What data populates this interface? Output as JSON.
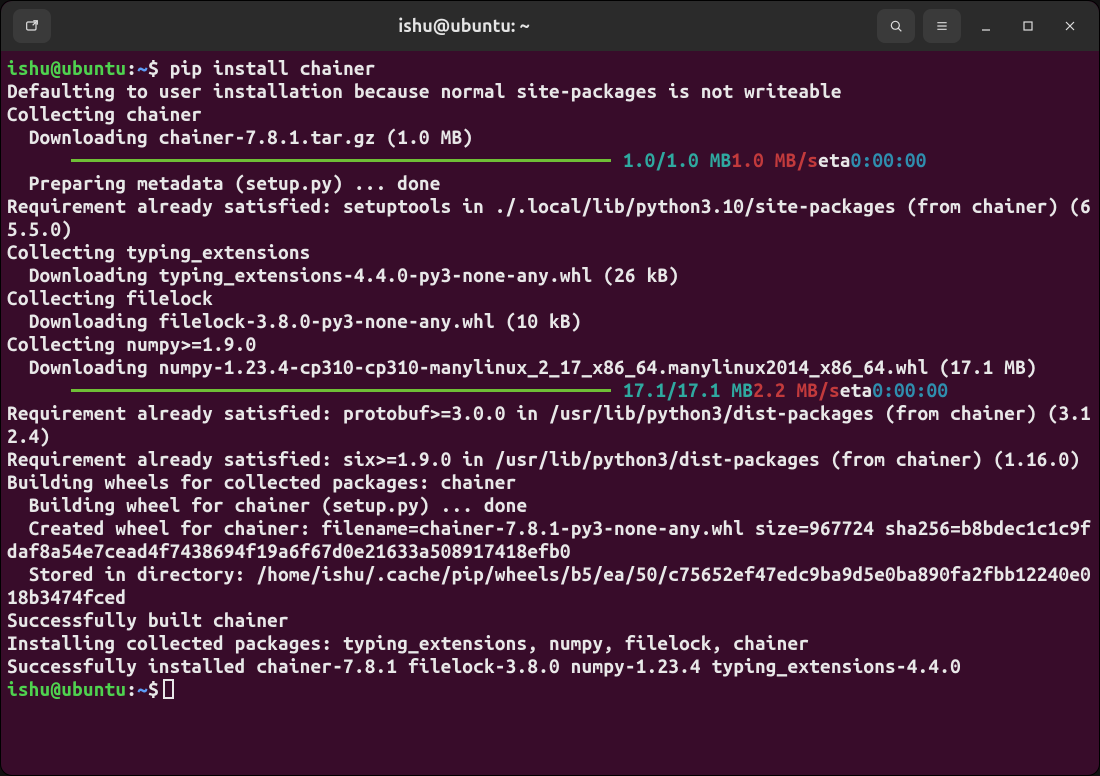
{
  "titlebar": {
    "title": "ishu@ubuntu: ~"
  },
  "prompt": {
    "user_host": "ishu@ubuntu",
    "sep": ":",
    "path": "~",
    "symbol": "$"
  },
  "command": "pip install chainer",
  "lines": {
    "l1": "Defaulting to user installation because normal site-packages is not writeable",
    "l2": "Collecting chainer",
    "l3": "  Downloading chainer-7.8.1.tar.gz (1.0 MB)",
    "progress1": {
      "done": "1.0/1.0 MB",
      "speed": "1.0 MB/s",
      "eta_lbl": "eta",
      "eta": "0:00:00"
    },
    "l4": "  Preparing metadata (setup.py) ... done",
    "l5": "Requirement already satisfied: setuptools in ./.local/lib/python3.10/site-packages (from chainer) (65.5.0)",
    "l6": "Collecting typing_extensions",
    "l7": "  Downloading typing_extensions-4.4.0-py3-none-any.whl (26 kB)",
    "l8": "Collecting filelock",
    "l9": "  Downloading filelock-3.8.0-py3-none-any.whl (10 kB)",
    "l10": "Collecting numpy>=1.9.0",
    "l11": "  Downloading numpy-1.23.4-cp310-cp310-manylinux_2_17_x86_64.manylinux2014_x86_64.whl (17.1 MB)",
    "progress2": {
      "done": "17.1/17.1 MB",
      "speed": "2.2 MB/s",
      "eta_lbl": "eta",
      "eta": "0:00:00"
    },
    "l12": "Requirement already satisfied: protobuf>=3.0.0 in /usr/lib/python3/dist-packages (from chainer) (3.12.4)",
    "l13": "Requirement already satisfied: six>=1.9.0 in /usr/lib/python3/dist-packages (from chainer) (1.16.0)",
    "l14": "Building wheels for collected packages: chainer",
    "l15": "  Building wheel for chainer (setup.py) ... done",
    "l16": "  Created wheel for chainer: filename=chainer-7.8.1-py3-none-any.whl size=967724 sha256=b8bdec1c1c9fdaf8a54e7cead4f7438694f19a6f67d0e21633a508917418efb0",
    "l17": "  Stored in directory: /home/ishu/.cache/pip/wheels/b5/ea/50/c75652ef47edc9ba9d5e0ba890fa2fbb12240e018b3474fced",
    "l18": "Successfully built chainer",
    "l19": "Installing collected packages: typing_extensions, numpy, filelock, chainer",
    "l20": "Successfully installed chainer-7.8.1 filelock-3.8.0 numpy-1.23.4 typing_extensions-4.4.0"
  }
}
